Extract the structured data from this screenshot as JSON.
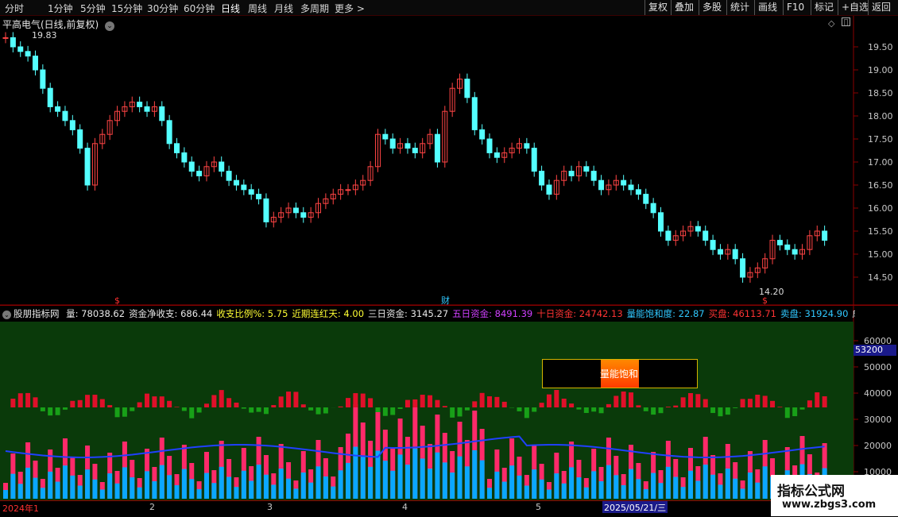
{
  "toolbar": {
    "periods": [
      "分时",
      "1分钟",
      "5分钟",
      "15分钟",
      "30分钟",
      "60分钟",
      "日线",
      "周线",
      "月线",
      "多周期",
      "更多"
    ],
    "more_arrow": ">",
    "buttons": [
      "复权",
      "叠加",
      "多股",
      "统计",
      "画线",
      "F10",
      "标记",
      "+自选",
      "返回"
    ]
  },
  "chart": {
    "title": "平高电气(日线,前复权)",
    "high_marker": "19.83",
    "low_marker": "14.20",
    "finance_marker": "财",
    "dividend_marker": "$",
    "price_ticks": [
      "19.50",
      "19.00",
      "18.50",
      "18.00",
      "17.50",
      "17.00",
      "16.50",
      "16.00",
      "15.50",
      "15.00",
      "14.50"
    ],
    "volume_ticks": [
      "60000",
      "50000",
      "40000",
      "30000",
      "20000",
      "10000"
    ],
    "volume_highlight": "53200"
  },
  "indicator": {
    "name": "股朋指标网",
    "items": [
      {
        "text": "量: 78038.62",
        "color": "#e8e8e8"
      },
      {
        "text": "资金净收支: 686.44",
        "color": "#e8e8e8"
      },
      {
        "text": "收支比例%: 5.75",
        "color": "#ffff33"
      },
      {
        "text": "近期连红天: 4.00",
        "color": "#ffff33"
      },
      {
        "text": "三日资金: 3145.27",
        "color": "#e8e8e8"
      },
      {
        "text": "五日资金: 8491.39",
        "color": "#d040ff"
      },
      {
        "text": "十日资金: 24742.13",
        "color": "#ff3333"
      },
      {
        "text": "量能饱和度: 22.87",
        "color": "#30c8ff"
      },
      {
        "text": "买盘: 46113.71",
        "color": "#ff3333"
      },
      {
        "text": "卖盘: 31924.90",
        "color": "#30c8ff"
      },
      {
        "text": "成交",
        "color": "#e8e8e8"
      }
    ],
    "popup_label": "量能饱和"
  },
  "dates": [
    "2024年1",
    "2",
    "3",
    "4",
    "5",
    "2025/05/21/三"
  ],
  "watermark": {
    "line1": "指标公式网",
    "line2": "www.zbgs3.com"
  },
  "colors": {
    "up": "#ff4444",
    "down": "#54ffff",
    "grid": "#8a0000",
    "volume_bg": "#0a3a0a",
    "axis_text": "#c8c8c8"
  }
}
